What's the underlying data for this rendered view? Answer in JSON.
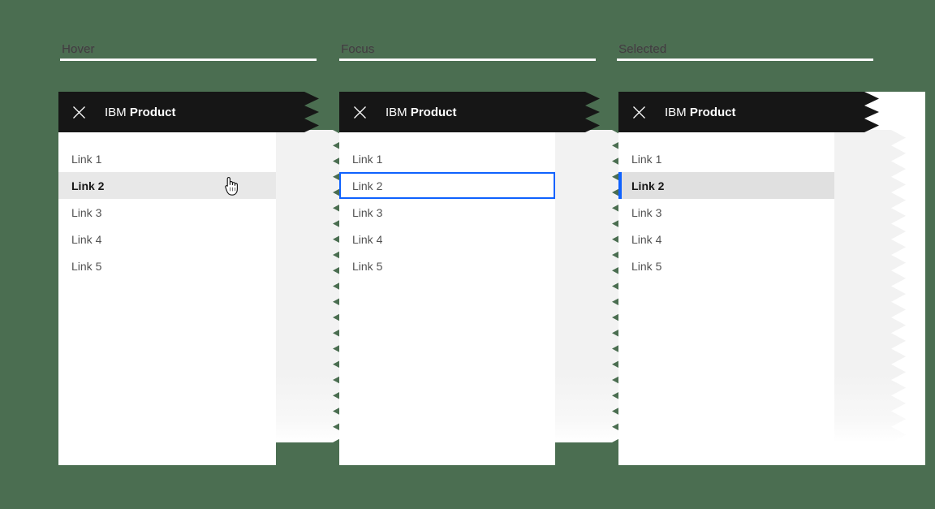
{
  "background_color": "#4b6e51",
  "accent_color": "#0f62fe",
  "header_color": "#161616",
  "sections": [
    {
      "id": "hover",
      "state_label": "Hover",
      "header": {
        "close_icon": "close-icon",
        "brand": "IBM",
        "product": "Product",
        "title_prefix": "IBM "
      },
      "links": [
        "Link 1",
        "Link 2",
        "Link 3",
        "Link 4",
        "Link 5"
      ],
      "active_index": 1,
      "active_state": "hover",
      "cursor": {
        "icon": "pointer-hand-cursor",
        "visible": true
      }
    },
    {
      "id": "focus",
      "state_label": "Focus",
      "header": {
        "close_icon": "close-icon",
        "brand": "IBM",
        "product": "Product",
        "title_prefix": "IBM "
      },
      "links": [
        "Link 1",
        "Link 2",
        "Link 3",
        "Link 4",
        "Link 5"
      ],
      "active_index": 1,
      "active_state": "focus",
      "cursor": {
        "icon": "pointer-hand-cursor",
        "visible": false
      }
    },
    {
      "id": "selected",
      "state_label": "Selected",
      "header": {
        "close_icon": "close-icon",
        "brand": "IBM",
        "product": "Product",
        "title_prefix": "IBM "
      },
      "links": [
        "Link 1",
        "Link 2",
        "Link 3",
        "Link 4",
        "Link 5"
      ],
      "active_index": 1,
      "active_state": "selected",
      "cursor": {
        "icon": "pointer-hand-cursor",
        "visible": false
      }
    }
  ]
}
